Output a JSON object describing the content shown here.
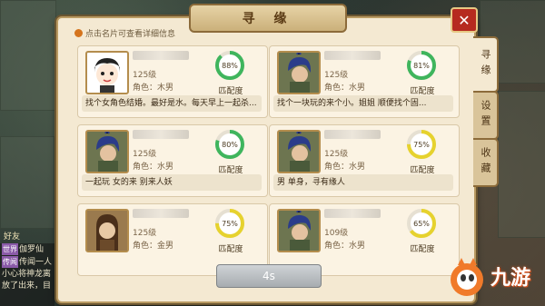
{
  "dialog": {
    "title": "寻 缘",
    "close_label": "✕",
    "hint": "点击名片可查看详细信息"
  },
  "tabs": [
    {
      "label": "寻缘",
      "active": true
    },
    {
      "label": "设置",
      "active": false
    },
    {
      "label": "收藏",
      "active": false
    }
  ],
  "match_label": "匹配度",
  "cards": [
    {
      "level": "125级",
      "role": "角色：木男",
      "match": 88,
      "match_text": "88%",
      "ring_color": "#3fb55d",
      "message": "找个女角色结婚。最好是水。每天早上一起杀...",
      "avatar": "avatar-cartoon"
    },
    {
      "level": "125级",
      "role": "角色：水男",
      "match": 81,
      "match_text": "81%",
      "ring_color": "#3fb55d",
      "message": "找个一块玩的来个小。姐姐  顺便找个固...",
      "avatar": "avatar-warrior"
    },
    {
      "level": "125级",
      "role": "角色：水男",
      "match": 80,
      "match_text": "80%",
      "ring_color": "#3fb55d",
      "message": "一起玩 女的来 别来人妖",
      "avatar": "avatar-warrior"
    },
    {
      "level": "125级",
      "role": "角色：水男",
      "match": 75,
      "match_text": "75%",
      "ring_color": "#e6d22e",
      "message": "男 单身，寻有缘人",
      "avatar": "avatar-warrior"
    },
    {
      "level": "125级",
      "role": "角色：金男",
      "match": 75,
      "match_text": "75%",
      "ring_color": "#e6d22e",
      "message": "",
      "avatar": "avatar-longhair"
    },
    {
      "level": "109级",
      "role": "角色：水男",
      "match": 65,
      "match_text": "65%",
      "ring_color": "#e6d22e",
      "message": "",
      "avatar": "avatar-warrior"
    }
  ],
  "timer_button": "4s",
  "chat": {
    "friends": "好友",
    "lines": [
      {
        "tag": "世界",
        "text": "伽罗仙"
      },
      {
        "tag": "传闻",
        "text": "传闻一人"
      },
      {
        "tag": "",
        "text": "小心将神龙离"
      },
      {
        "tag": "",
        "text": "放了出来，目"
      }
    ]
  },
  "logo": {
    "text": "九游"
  }
}
